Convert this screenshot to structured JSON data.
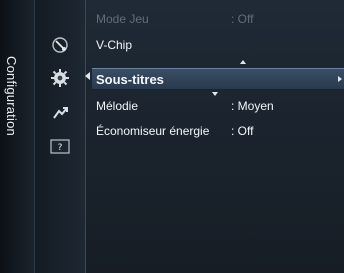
{
  "sidebar": {
    "title": "Configuration",
    "icons": [
      "satellite-dish-icon",
      "gear-icon",
      "support-icon",
      "help-icon"
    ],
    "help_label": "?"
  },
  "menu": {
    "items": [
      {
        "label": "Mode Jeu",
        "value": ": Off",
        "state": "disabled"
      },
      {
        "label": "V-Chip",
        "value": "",
        "state": "normal"
      },
      {
        "label": "Sous-titres",
        "value": "",
        "state": "selected"
      },
      {
        "label": "Mélodie",
        "value": ": Moyen",
        "state": "normal"
      },
      {
        "label": "Économiseur énergie",
        "value": ": Off",
        "state": "normal"
      }
    ]
  },
  "colors": {
    "background": "#1b242e",
    "selected": "#34485e",
    "text": "#f3f6f9",
    "disabled_text": "#5f6e7c"
  }
}
